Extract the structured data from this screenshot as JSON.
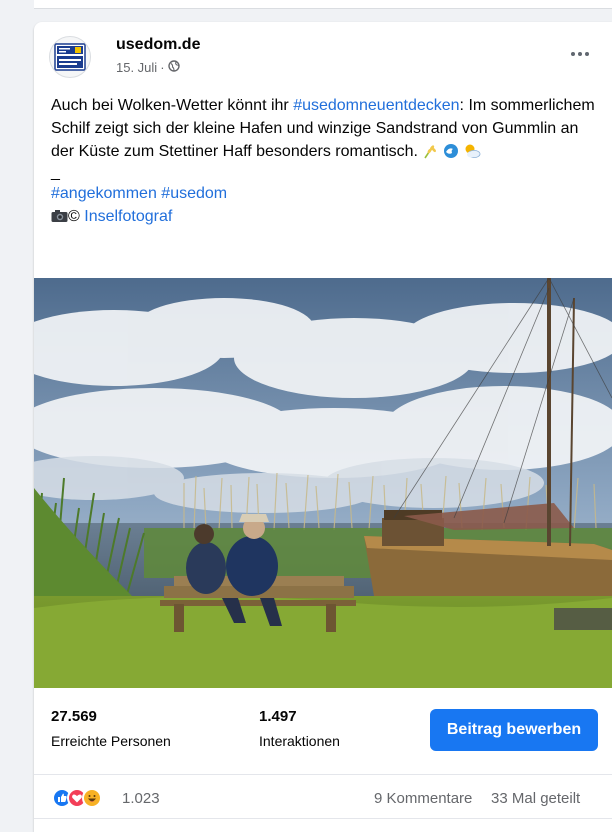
{
  "post": {
    "page_name": "usedom.de",
    "avatar_logo_text": "INSEL USEDOM",
    "date": "15. Juli",
    "date_separator": "·",
    "more_icon": "more-horizontal-icon",
    "privacy_icon": "globe-icon",
    "text_line1_pre": "Auch bei Wolken-Wetter könnt ihr ",
    "hashtag_main": "#usedomneuentdecken",
    "text_rest": ": Im sommerlichem Schilf zeigt sich der kleine Hafen und winzige Sandstrand von Gummlin an der Küste zum Stettiner Haff besonders romantisch. ",
    "emoji_icons": [
      "wheat-icon",
      "wave-icon",
      "sun-behind-cloud-icon"
    ],
    "separator": "_",
    "hashtag_1": "#angekommen",
    "hashtag_2": "#usedom",
    "camera_icon": "camera-icon",
    "copyright": "©",
    "photographer": "Inselfotograf"
  },
  "stats": {
    "reach_value": "27.569",
    "reach_label": "Erreichte Personen",
    "interactions_value": "1.497",
    "interactions_label": "Interaktionen",
    "promote_label": "Beitrag bewerben"
  },
  "reactions": {
    "icons": [
      "like-icon",
      "love-icon",
      "haha-icon"
    ],
    "count": "1.023",
    "comments": "9 Kommentare",
    "shares": "33 Mal geteilt"
  },
  "colors": {
    "accent": "#1877f2",
    "link": "#216fdb",
    "secondary_text": "#65676b",
    "background": "#f0f2f5"
  }
}
